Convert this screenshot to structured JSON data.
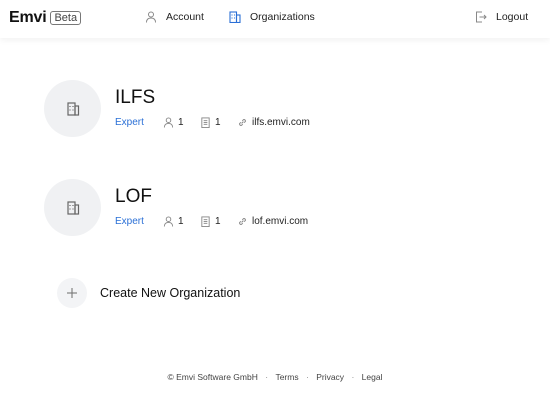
{
  "header": {
    "logo": "Emvi",
    "badge": "Beta",
    "nav": {
      "account": "Account",
      "organizations": "Organizations",
      "logout": "Logout"
    },
    "accent_color": "#2a6fd6"
  },
  "organizations": [
    {
      "name": "ILFS",
      "plan": "Expert",
      "members": "1",
      "pages": "1",
      "domain": "ilfs.emvi.com"
    },
    {
      "name": "LOF",
      "plan": "Expert",
      "members": "1",
      "pages": "1",
      "domain": "lof.emvi.com"
    }
  ],
  "create": {
    "label": "Create New Organization"
  },
  "footer": {
    "copyright": "© Emvi Software GmbH",
    "sep": "·",
    "terms": "Terms",
    "privacy": "Privacy",
    "legal": "Legal"
  }
}
